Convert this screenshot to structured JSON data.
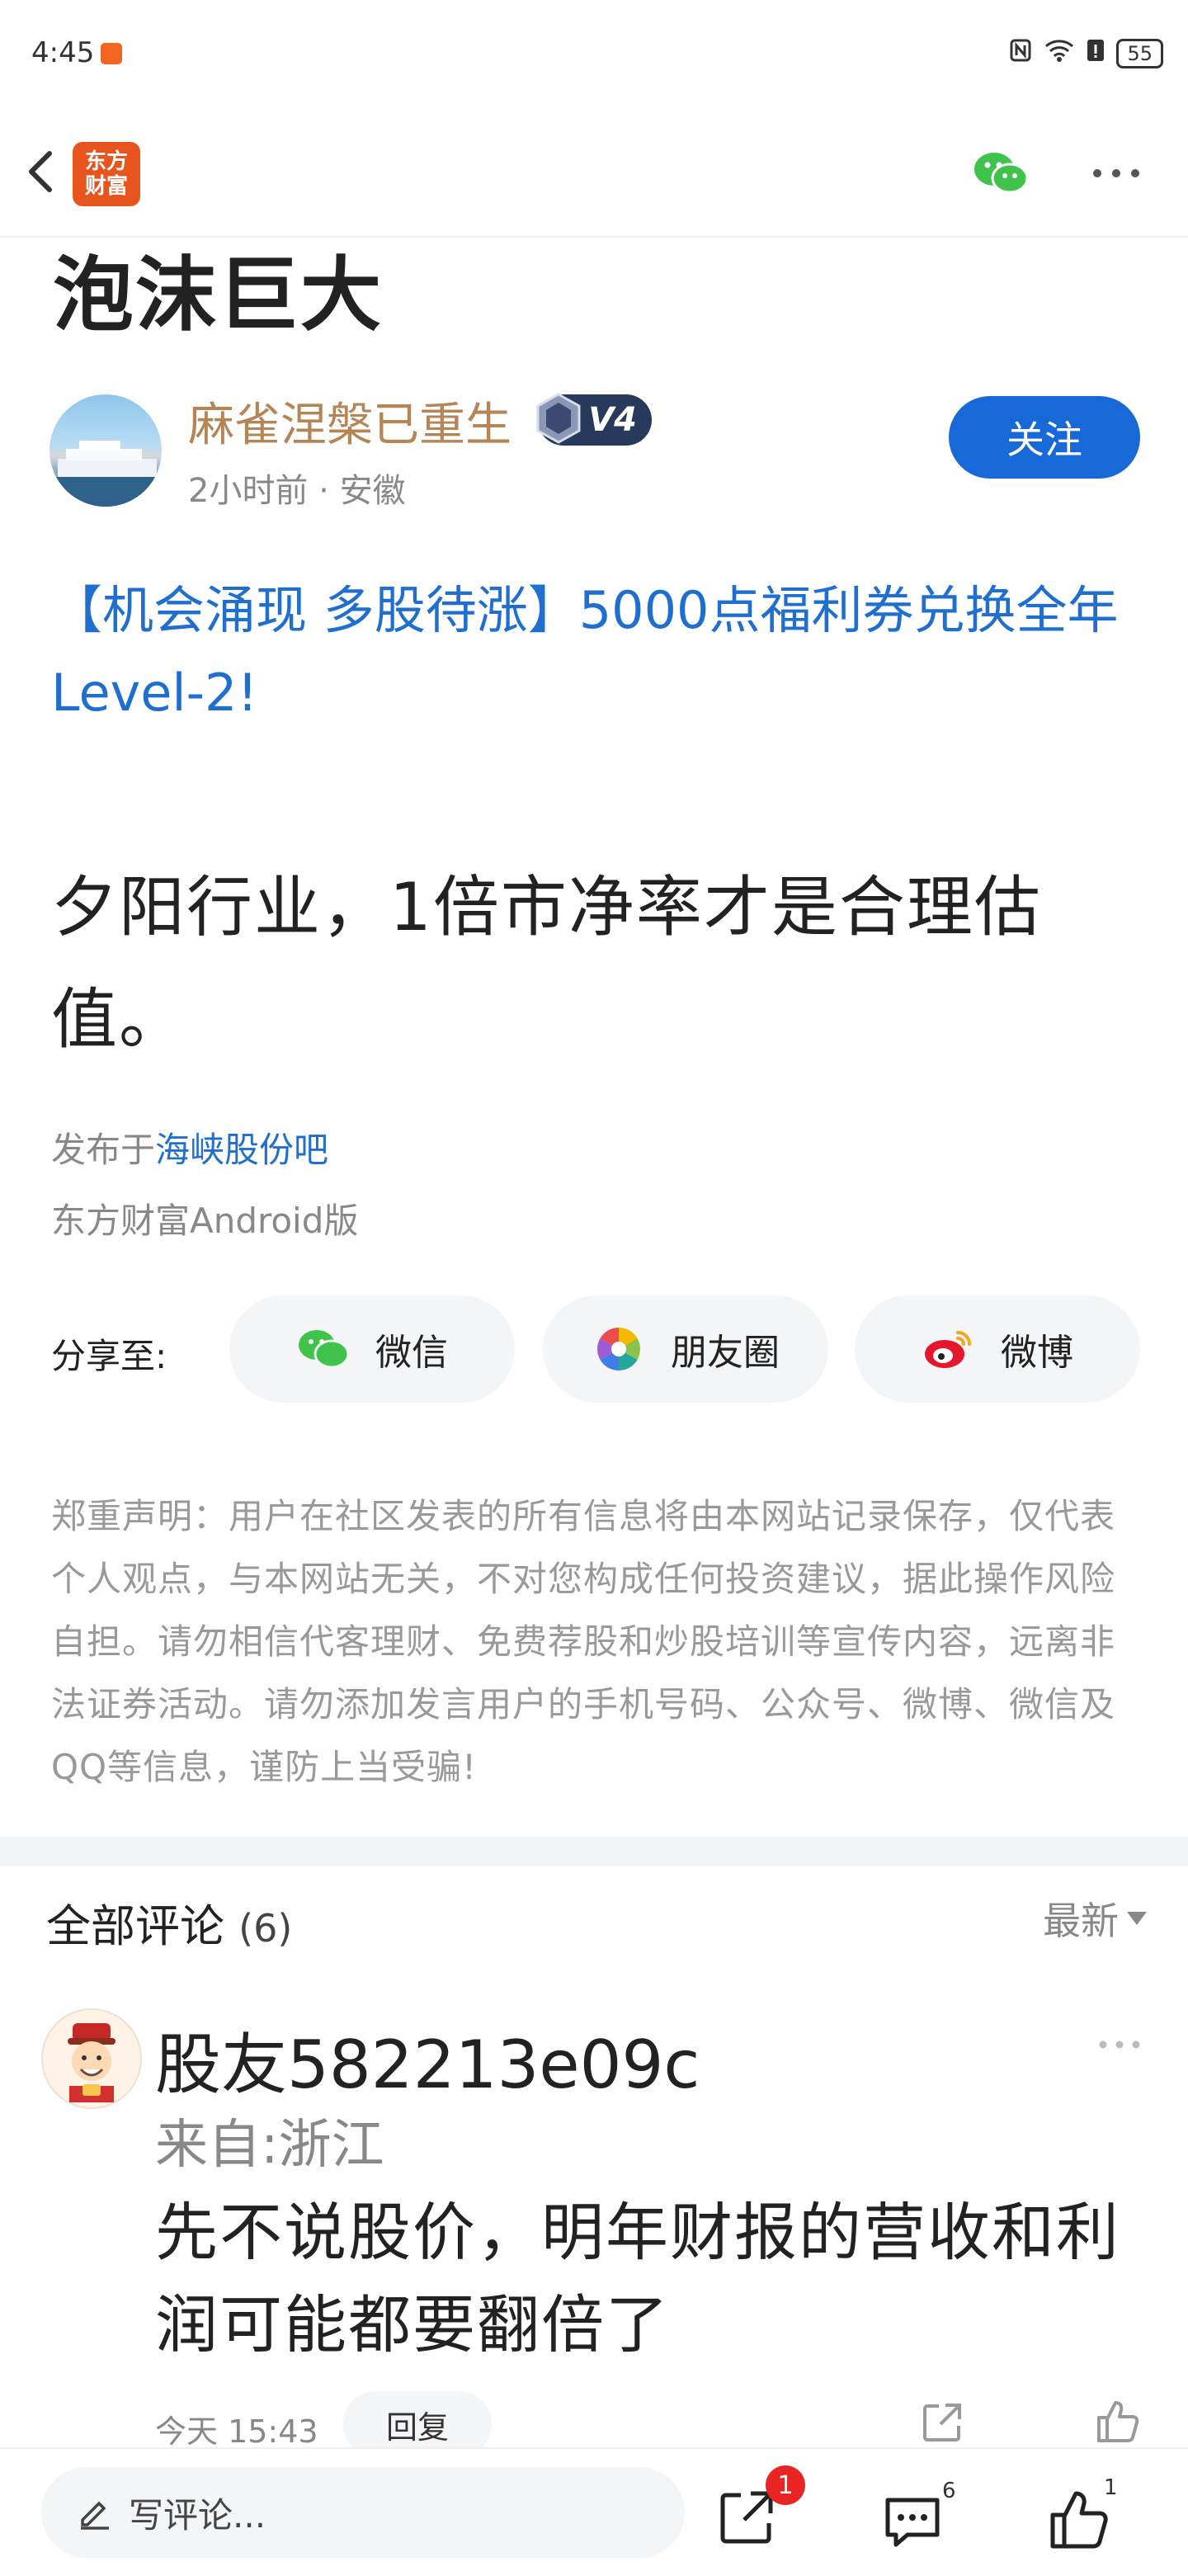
{
  "status_bar": {
    "time": "4:45",
    "battery": "55"
  },
  "nav": {
    "logo_line1": "东方",
    "logo_line2": "财富"
  },
  "post": {
    "title": "泡沫巨大",
    "author": "麻雀涅槃已重生",
    "level": "V4",
    "time_location": "2小时前 · 安徽",
    "follow_label": "关注",
    "promo_link": "【机会涌现 多股待涨】5000点福利券兑换全年Level-2!",
    "content": "夕阳行业，1倍市净率才是合理估值。",
    "published_prefix": "发布于",
    "published_bar": "海峡股份吧",
    "client": "东方财富Android版"
  },
  "share": {
    "label": "分享至:",
    "wechat": "微信",
    "moments": "朋友圈",
    "weibo": "微博"
  },
  "disclaimer": "郑重声明：用户在社区发表的所有信息将由本网站记录保存，仅代表个人观点，与本网站无关，不对您构成任何投资建议，据此操作风险自担。请勿相信代客理财、免费荐股和炒股培训等宣传内容，远离非法证券活动。请勿添加发言用户的手机号码、公众号、微博、微信及QQ等信息，谨防上当受骗!",
  "comments": {
    "header": "全部评论",
    "count": "(6)",
    "sort": "最新",
    "items": [
      {
        "user": "股友582213e09c",
        "location": "来自:浙江",
        "text": "先不说股价，明年财报的营收和利润可能都要翻倍了",
        "time": "今天 15:43",
        "reply_label": "回复"
      }
    ]
  },
  "bottom": {
    "write_placeholder": "写评论...",
    "share_badge": "1",
    "comment_count": "6",
    "like_count": "1"
  }
}
